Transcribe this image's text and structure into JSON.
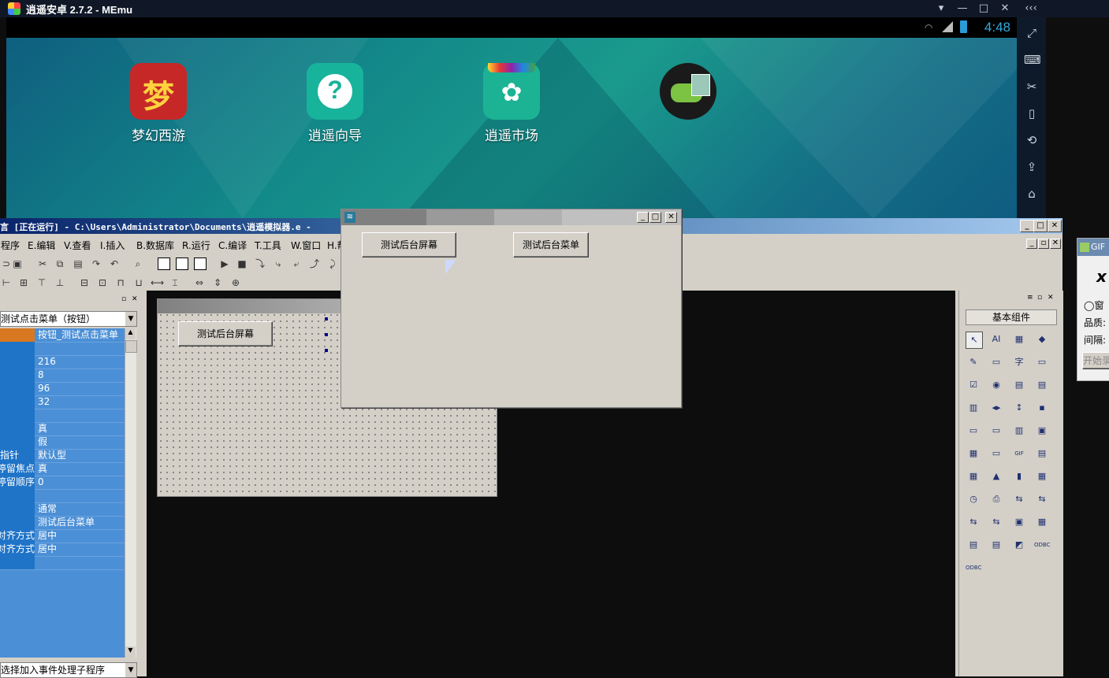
{
  "memu": {
    "title": "逍遥安卓 2.7.2 - MEmu",
    "time": "4:48",
    "controls": [
      "▾",
      "—",
      "□",
      "✕",
      "‹‹‹"
    ],
    "sidebar_icons": [
      "fullscreen-icon",
      "keyboard-icon",
      "cut-icon",
      "shake-icon",
      "rotate-icon",
      "apk-icon",
      "broom-icon"
    ]
  },
  "apps": [
    {
      "label": "梦幻西游",
      "icon": "梦",
      "color": "#d22c2c"
    },
    {
      "label": "逍遥向导",
      "icon": "?",
      "color": "#1ab39a"
    },
    {
      "label": "逍遥市场",
      "icon": "✿",
      "color": "#1bb394"
    },
    {
      "label": "",
      "icon": "🎮",
      "color": "#1a1a1a"
    }
  ],
  "ide": {
    "title": "言 [正在运行] - C:\\Users\\Administrator\\Documents\\逍遥模拟器.e -",
    "menu": [
      "程序",
      "E.编辑",
      "V.查看",
      "I.插入",
      "B.数据库",
      "R.运行",
      "C.编译",
      "T.工具",
      "W.窗口",
      "H.帮"
    ],
    "props_combo": "测试点击菜单（按钮）",
    "props": [
      {
        "k": "",
        "v": "按钮_测试点击菜单"
      },
      {
        "k": "",
        "v": ""
      },
      {
        "k": "",
        "v": "216"
      },
      {
        "k": "",
        "v": "8"
      },
      {
        "k": "",
        "v": "96"
      },
      {
        "k": "",
        "v": "32"
      },
      {
        "k": "",
        "v": ""
      },
      {
        "k": "",
        "v": "真"
      },
      {
        "k": "",
        "v": "假"
      },
      {
        "k": "指针",
        "v": "默认型"
      },
      {
        "k": "停留焦点",
        "v": "真"
      },
      {
        "k": "停留顺序",
        "v": "0"
      },
      {
        "k": "",
        "v": ""
      },
      {
        "k": "",
        "v": "通常"
      },
      {
        "k": "",
        "v": "测试后台菜单"
      },
      {
        "k": "横向对齐方式",
        "v": "居中"
      },
      {
        "k": "纵向对齐方式",
        "v": "居中"
      },
      {
        "k": "",
        "v": ""
      }
    ],
    "event_combo": "选择加入事件处理子程序",
    "design_button": "测试后台屏幕",
    "components_title": "基本组件",
    "component_icons": [
      "↖",
      "AI",
      "▦",
      "◆",
      "✎",
      "▭",
      "字",
      "▭",
      "☑",
      "◉",
      "▤",
      "▤",
      "▥",
      "◂▸",
      "↕",
      "▪",
      "▭",
      "▭",
      "▥",
      "▣",
      "▦",
      "▭",
      "GIF",
      "▤",
      "▦",
      "▲",
      "▮",
      "▦",
      "◷",
      "⎙",
      "⇆",
      "⇆",
      "⇆",
      "⇆",
      "▣",
      "▦",
      "▤",
      "▤",
      "◩",
      "ODBC",
      "ODBC"
    ]
  },
  "runwin": {
    "btn1": "测试后台屏幕",
    "btn2": "测试后台菜单"
  },
  "gif": {
    "title": "GIF",
    "line1": "窗",
    "line2": "品质:",
    "line3": "间隔:",
    "btn": "开始录"
  }
}
